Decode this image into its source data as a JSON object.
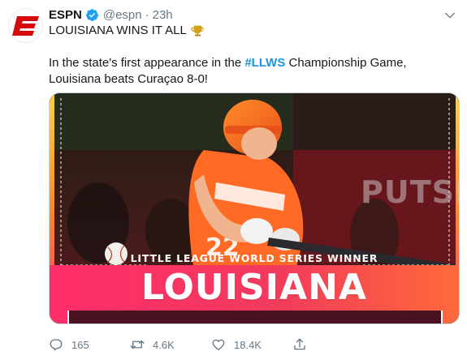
{
  "account": {
    "display_name": "ESPN",
    "handle": "@espn",
    "separator": "·",
    "time": "23h",
    "verified": true,
    "avatar_icon": "espn-logo-icon",
    "brand_color": "#d50a0a"
  },
  "tweet": {
    "headline": "LOUISIANA WINS IT ALL",
    "headline_emoji": "trophy-icon",
    "body_before": "In the state's first appearance in the ",
    "hashtag": "#LLWS",
    "body_after": " Championship Game, Louisiana beats Curaçao 8-0!",
    "hashtag_color": "#1b95e0"
  },
  "media": {
    "subtitle": "LITTLE LEAGUE WORLD SERIES WINNER",
    "title": "LOUISIANA",
    "background_sign": "PUTSEE",
    "jersey_number": "22",
    "gradient_colors": [
      "#ff3d6e",
      "#e8315f",
      "#ff7a3d"
    ]
  },
  "actions": {
    "reply_count": "165",
    "retweet_count": "4.6K",
    "like_count": "18.4K"
  }
}
